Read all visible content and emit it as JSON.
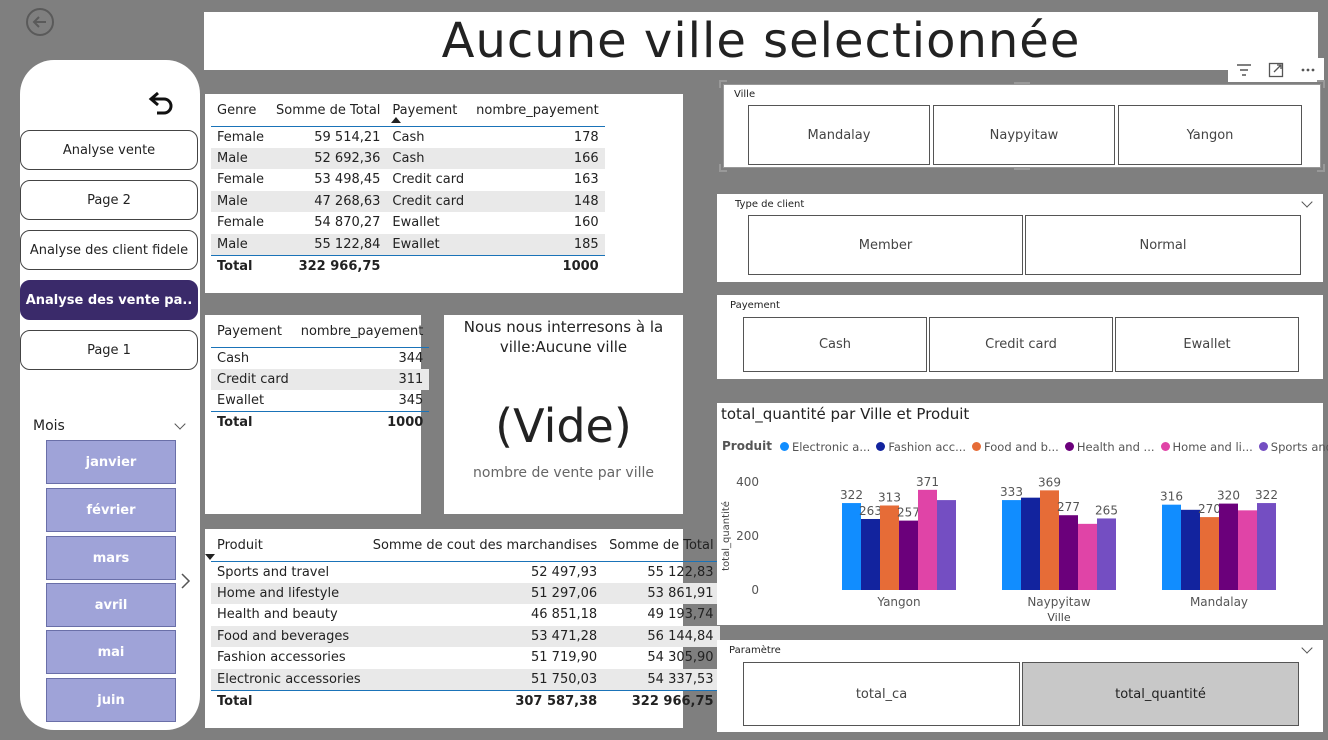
{
  "page": {
    "title": "Aucune ville selectionnée"
  },
  "sidebar": {
    "nav": [
      "Analyse vente",
      "Page 2",
      "Analyse des client fidele",
      "Analyse des vente pa..",
      "Page 1"
    ],
    "mois_label": "Mois",
    "months": [
      "janvier",
      "février",
      "mars",
      "avril",
      "mai",
      "juin"
    ]
  },
  "table_genre": {
    "headers": [
      "Genre",
      "Somme de Total",
      "Payement",
      "nombre_payement"
    ],
    "rows": [
      [
        "Female",
        "59 514,21",
        "Cash",
        "178"
      ],
      [
        "Male",
        "52 692,36",
        "Cash",
        "166"
      ],
      [
        "Female",
        "53 498,45",
        "Credit card",
        "163"
      ],
      [
        "Male",
        "47 268,63",
        "Credit card",
        "148"
      ],
      [
        "Female",
        "54 870,27",
        "Ewallet",
        "160"
      ],
      [
        "Male",
        "55 122,84",
        "Ewallet",
        "185"
      ]
    ],
    "total": [
      "Total",
      "322 966,75",
      "",
      "1000"
    ]
  },
  "table_payement": {
    "headers": [
      "Payement",
      "nombre_payement"
    ],
    "rows": [
      [
        "Cash",
        "344"
      ],
      [
        "Credit card",
        "311"
      ],
      [
        "Ewallet",
        "345"
      ]
    ],
    "total": [
      "Total",
      "1000"
    ]
  },
  "card": {
    "heading": "Nous nous interresons à la ville:Aucune ville",
    "value": "(Vide)",
    "caption": "nombre de vente par ville"
  },
  "table_produit": {
    "headers": [
      "Produit",
      "Somme de cout des marchandises",
      "Somme de Total"
    ],
    "rows": [
      [
        "Sports and travel",
        "52 497,93",
        "55 122,83"
      ],
      [
        "Home and lifestyle",
        "51 297,06",
        "53 861,91"
      ],
      [
        "Health and beauty",
        "46 851,18",
        "49 193,74"
      ],
      [
        "Food and beverages",
        "53 471,28",
        "56 144,84"
      ],
      [
        "Fashion accessories",
        "51 719,90",
        "54 305,90"
      ],
      [
        "Electronic accessories",
        "51 750,03",
        "54 337,53"
      ]
    ],
    "total": [
      "Total",
      "307 587,38",
      "322 966,75"
    ]
  },
  "slicers": {
    "ville": {
      "title": "Ville",
      "options": [
        "Mandalay",
        "Naypyitaw",
        "Yangon"
      ]
    },
    "type_client": {
      "title": "Type de client",
      "options": [
        "Member",
        "Normal"
      ]
    },
    "payement": {
      "title": "Payement",
      "options": [
        "Cash",
        "Credit card",
        "Ewallet"
      ]
    },
    "parametre": {
      "title": "Paramètre",
      "options": [
        "total_ca",
        "total_quantité"
      ],
      "selected": "total_quantité"
    }
  },
  "chart_data": {
    "type": "bar",
    "title": "total_quantité par Ville et Produit",
    "legend_title": "Produit",
    "legend_labels": [
      "Electronic a...",
      "Fashion acc...",
      "Food and b...",
      "Health and ...",
      "Home and li...",
      "Sports and ..."
    ],
    "xlabel": "Ville",
    "ylabel": "total_quantité",
    "ylim": [
      0,
      400
    ],
    "yticks": [
      0,
      200,
      400
    ],
    "categories": [
      "Yangon",
      "Naypyitaw",
      "Mandalay"
    ],
    "series": [
      {
        "name": "Electronic a...",
        "color": "#118DFF",
        "values": [
          322,
          333,
          316
        ]
      },
      {
        "name": "Fashion acc...",
        "color": "#12239E",
        "values": [
          263,
          342,
          297
        ]
      },
      {
        "name": "Food and b...",
        "color": "#E66C37",
        "values": [
          313,
          369,
          270
        ]
      },
      {
        "name": "Health and ...",
        "color": "#6B007B",
        "values": [
          257,
          277,
          320
        ]
      },
      {
        "name": "Home and li...",
        "color": "#E044A7",
        "values": [
          371,
          245,
          295
        ]
      },
      {
        "name": "Sports and ...",
        "color": "#744EC2",
        "values": [
          333,
          265,
          322
        ]
      }
    ],
    "data_labels": [
      [
        322,
        263,
        313,
        257,
        371,
        null
      ],
      [
        333,
        null,
        369,
        277,
        null,
        265
      ],
      [
        316,
        null,
        270,
        320,
        null,
        322
      ]
    ]
  }
}
